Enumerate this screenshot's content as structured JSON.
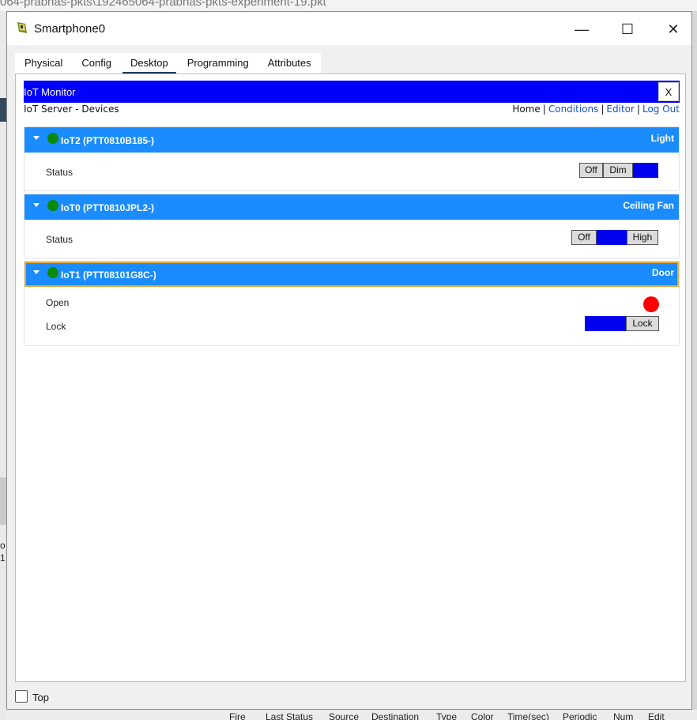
{
  "background": {
    "path_title": "064-prabhas-pkts\\192465064-prabhas-pkts-experiment-19.pkt",
    "left_text": "o\n1",
    "bottom_headers": [
      "Fire",
      "Last Status",
      "Source",
      "Destination",
      "Type",
      "Color",
      "Time(sec)",
      "Periodic",
      "Num",
      "Edit"
    ]
  },
  "window": {
    "title": "Smartphone0",
    "minimize": "—",
    "maximize": "☐",
    "close": "✕"
  },
  "tabs": [
    {
      "label": "Physical"
    },
    {
      "label": "Config"
    },
    {
      "label": "Desktop",
      "active": true
    },
    {
      "label": "Programming"
    },
    {
      "label": "Attributes"
    }
  ],
  "iot": {
    "bar_title": "IoT Monitor",
    "close_label": "X",
    "server_title": "IoT Server - Devices",
    "nav": {
      "home": "Home",
      "conditions": "Conditions",
      "editor": "Editor",
      "logout": "Log Out",
      "separator": "|"
    }
  },
  "devices": [
    {
      "name": "IoT2 (PTT0810B185-)",
      "type": "Light",
      "status_color": "#0a8a0a",
      "rows": [
        {
          "label": "Status",
          "options": [
            "Off",
            "Dim",
            ""
          ],
          "selected": 2
        }
      ]
    },
    {
      "name": "IoT0 (PTT0810JPL2-)",
      "type": "Ceiling Fan",
      "status_color": "#0a8a0a",
      "rows": [
        {
          "label": "Status",
          "options": [
            "Off",
            "",
            "High"
          ],
          "selected": 1
        }
      ]
    },
    {
      "name": "IoT1 (PTT08101G8C-)",
      "type": "Door",
      "status_color": "#0a8a0a",
      "rows": [
        {
          "label": "Open",
          "indicator": "red"
        },
        {
          "label": "Lock",
          "options": [
            "",
            "Lock"
          ],
          "selected": 0
        }
      ]
    }
  ],
  "footer": {
    "top_label": "Top",
    "top_checked": false
  },
  "colors": {
    "iot_bar": "#0000ff",
    "device_header": "#1a8cff",
    "selected_option": "#0000ee",
    "indicator_red": "#ff0000"
  }
}
